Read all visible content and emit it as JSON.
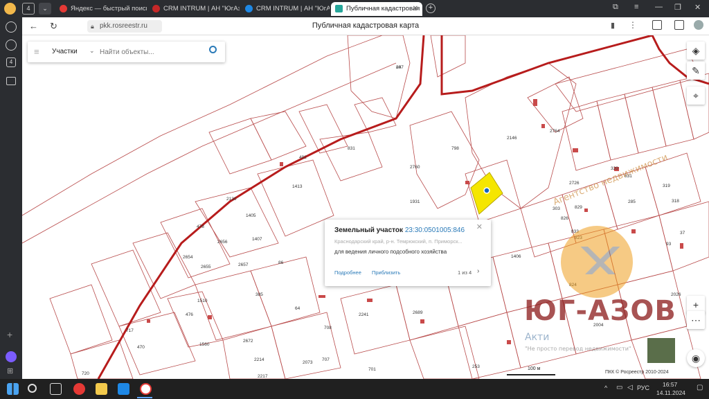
{
  "browser": {
    "tab_count": "4",
    "tabs": [
      {
        "title": "Яндекс — быстрый поиск",
        "color": "#e53935"
      },
      {
        "title": "CRM INTRUM | АН \"ЮгАз",
        "color": "#c62828"
      },
      {
        "title": "CRM INTRUM | АН \"ЮгАз",
        "color": "#1e88e5"
      },
      {
        "title": "Публичная кадастровая",
        "color": "#26a69a"
      }
    ],
    "url": "pkk.rosreestr.ru",
    "page_title": "Публичная кадастровая карта",
    "sidebar_badge": "4"
  },
  "search": {
    "category": "Участки",
    "placeholder": "Найти объекты..."
  },
  "popup": {
    "type_label": "Земельный участок",
    "cadastral_number": "23:30:0501005:846",
    "address": "Краснодарский край, р-н. Темрюкский, п. Приморск...",
    "usage": "для ведения личного подсобного хозяйства",
    "details_link": "Подробнее",
    "zoom_link": "Приблизить",
    "pager": "1 из 4"
  },
  "map": {
    "scale_label": "100 м",
    "copyright": "ПКК © Росреестр 2010-2024",
    "parcel_labels": [
      "807",
      "2146",
      "2760",
      "798",
      "1931",
      "831",
      "492",
      "1413",
      "1405",
      "1407",
      "2130",
      "478",
      "2654",
      "2655",
      "2656",
      "2657",
      "86",
      "476",
      "1510",
      "717",
      "470",
      "720",
      "1560",
      "2672",
      "2214",
      "2073",
      "2217",
      "701",
      "253",
      "708",
      "2241",
      "2689",
      "707",
      "64",
      "385",
      "2764",
      "320",
      "319",
      "318",
      "285",
      "303",
      "826",
      "833",
      "1406",
      "824",
      "2004",
      "2026",
      "93",
      "37",
      "823",
      "829",
      "831",
      "2726",
      "24"
    ],
    "highlight_color": "#f5e600",
    "boundary_color": "#b71c1c"
  },
  "watermark": {
    "brand": "ЮГ-АЗОВ",
    "subtitle": "Агентство недвижимости",
    "tagline_prefix": "Акти",
    "tagline_rest": "\"Не просто перевод недвижимости\""
  },
  "taskbar": {
    "time": "16:57",
    "date": "14.11.2024",
    "lang": "РУС"
  }
}
